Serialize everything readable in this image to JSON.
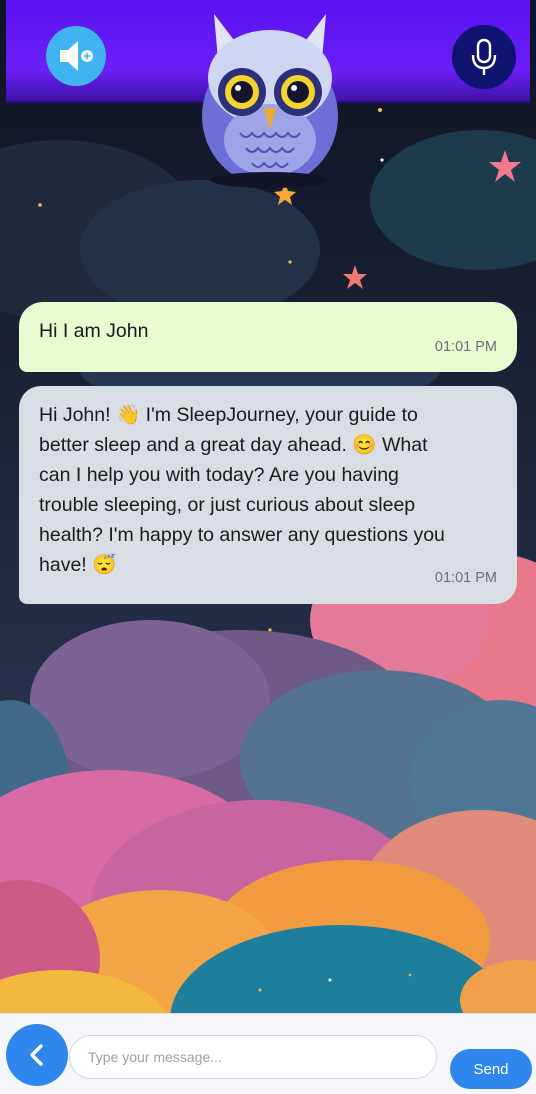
{
  "header": {
    "speaker_icon": "speaker-plus-icon",
    "mic_icon": "microphone-icon",
    "owl_icon": "owl-mascot-icon"
  },
  "messages": [
    {
      "sender": "user",
      "text": "Hi I am John",
      "time": "01:01 PM"
    },
    {
      "sender": "bot",
      "lines": [
        "Hi John! 👋 I'm SleepJourney, your guide to",
        "better sleep and a great day ahead. 😊 What",
        "can I help you with today? Are you having",
        "trouble sleeping, or just curious about sleep",
        "health? I'm happy to answer any questions you",
        "have! 😴"
      ],
      "time": "01:01 PM"
    }
  ],
  "composer": {
    "placeholder": "Type your message...",
    "value": "",
    "send_label": "Send",
    "back_icon": "chevron-left-icon"
  },
  "colors": {
    "header": "#6a1ff5",
    "user_bubble": "#e9fbd0",
    "bot_bubble": "#d9dde4",
    "accent": "#2f86ec"
  }
}
